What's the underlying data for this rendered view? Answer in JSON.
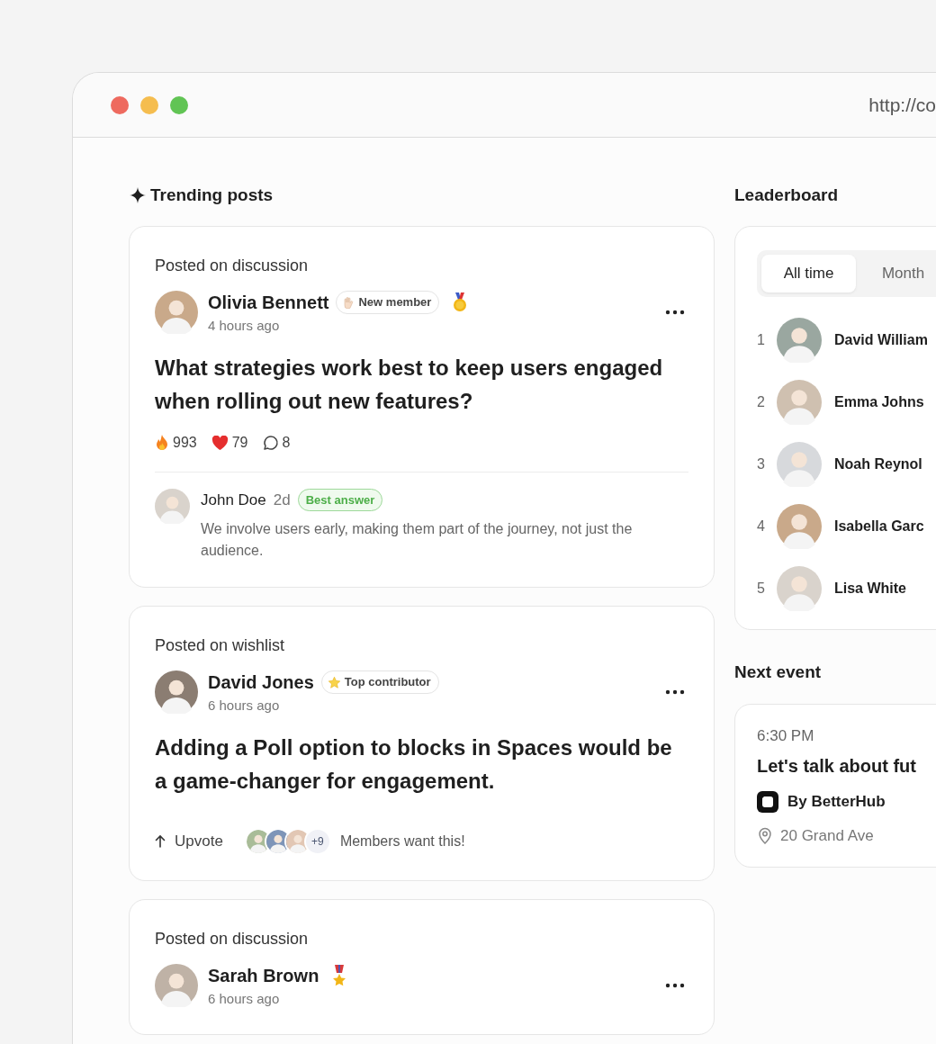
{
  "browser": {
    "url": "http://co"
  },
  "trending": {
    "title": "Trending posts",
    "posts": [
      {
        "posted_on": "Posted on discussion",
        "author": "Olivia Bennett",
        "badge": {
          "kind": "wave",
          "label": "New member"
        },
        "award": {
          "kind": "gold-medal"
        },
        "time": "4 hours ago",
        "title": "What strategies work best to keep users engaged when rolling out new features?",
        "stats": {
          "fire": "993",
          "likes": "79",
          "comments": "8"
        },
        "reply": {
          "author": "John Doe",
          "time": "2d",
          "badge": "Best answer",
          "text": "We involve users early, making them part of the journey, not just the audience."
        }
      },
      {
        "posted_on": "Posted on wishlist",
        "author": "David Jones",
        "badge": {
          "kind": "star",
          "label": "Top contributor"
        },
        "time": "6 hours ago",
        "title": "Adding a Poll option to blocks in Spaces would be a game-changer for engagement.",
        "upvote": {
          "label": "Upvote",
          "more_count": "+9",
          "note": "Members want this!"
        }
      },
      {
        "posted_on": "Posted on discussion",
        "author": "Sarah Brown",
        "award": {
          "kind": "military-medal"
        },
        "time": "6 hours ago"
      }
    ]
  },
  "leaderboard": {
    "title": "Leaderboard",
    "tabs": [
      {
        "label": "All time",
        "selected": true
      },
      {
        "label": "Month",
        "selected": false
      }
    ],
    "members": [
      {
        "rank": "1",
        "name": "David William"
      },
      {
        "rank": "2",
        "name": "Emma Johns"
      },
      {
        "rank": "3",
        "name": "Noah Reynol"
      },
      {
        "rank": "4",
        "name": "Isabella Garc"
      },
      {
        "rank": "5",
        "name": "Lisa White"
      }
    ]
  },
  "next_event": {
    "title": "Next event",
    "time": "6:30 PM",
    "name": "Let's talk about fut",
    "host": "By BetterHub",
    "location": "20 Grand Ave"
  }
}
